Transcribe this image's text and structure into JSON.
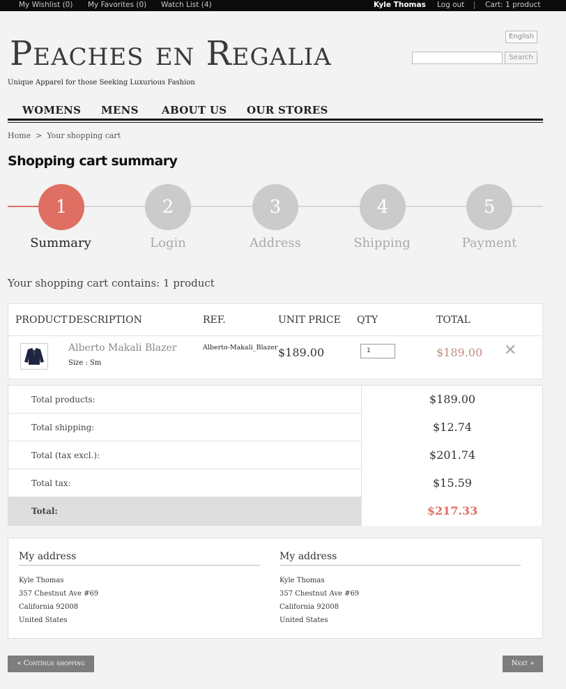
{
  "topbar": {
    "wishlist": "My Wishlist (0)",
    "favorites": "My Favorites (0)",
    "watchlist": "Watch List (4)",
    "user": "Kyle Thomas",
    "logout": "Log out",
    "cart": "Cart: 1 product"
  },
  "header": {
    "language": "English",
    "logo": "Peaches en Regalia",
    "tagline": "Unique Apparel for those Seeking Luxurious Fashion",
    "search_button": "Search",
    "search_value": ""
  },
  "nav": {
    "items": [
      {
        "label": "WOMENS"
      },
      {
        "label": "MENS"
      },
      {
        "label": "ABOUT US"
      },
      {
        "label": "OUR STORES"
      }
    ]
  },
  "breadcrumb": {
    "home": "Home",
    "separator": ">",
    "current": "Your shopping cart"
  },
  "page_title": "Shopping cart summary",
  "steps": [
    {
      "number": "1",
      "label": "Summary",
      "active": true
    },
    {
      "number": "2",
      "label": "Login",
      "active": false
    },
    {
      "number": "3",
      "label": "Address",
      "active": false
    },
    {
      "number": "4",
      "label": "Shipping",
      "active": false
    },
    {
      "number": "5",
      "label": "Payment",
      "active": false
    }
  ],
  "cart_summary_text": "Your shopping cart contains: 1 product",
  "cart_table": {
    "headers": [
      "PRODUCT",
      "DESCRIPTION",
      "REF.",
      "UNIT PRICE",
      "QTY",
      "TOTAL"
    ],
    "items": [
      {
        "name": "Alberto Makali Blazer",
        "size": "Size : Sm",
        "ref": "Alberto-Makali_Blazer",
        "unit_price": "$189.00",
        "qty": "1",
        "total": "$189.00",
        "remove": "✕"
      }
    ]
  },
  "totals": {
    "rows": [
      {
        "label": "Total products:",
        "value": "$189.00"
      },
      {
        "label": "Total shipping:",
        "value": "$12.74"
      },
      {
        "label": "Total (tax excl.):",
        "value": "$201.74"
      },
      {
        "label": "Total tax:",
        "value": "$15.59"
      },
      {
        "label": "Total:",
        "value": "$217.33"
      }
    ]
  },
  "addresses": [
    {
      "title": "My address",
      "lines": [
        "Kyle Thomas",
        "357 Chestnut Ave #69",
        "California 92008",
        "United States"
      ]
    },
    {
      "title": "My address",
      "lines": [
        "Kyle Thomas",
        "357 Chestnut Ave #69",
        "California 92008",
        "United States"
      ]
    }
  ],
  "buttons": {
    "continue": "« Continue shopping",
    "next": "Next »"
  },
  "colors": {
    "accent": "#de6f62",
    "step_inactive": "#cbcbcb",
    "topbar": "#0b0b0b",
    "button": "#7d7d7d"
  }
}
